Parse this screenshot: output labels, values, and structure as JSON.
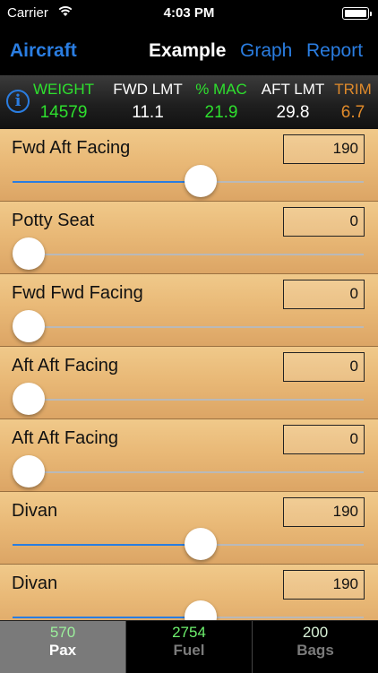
{
  "status": {
    "carrier": "Carrier",
    "time": "4:03 PM"
  },
  "nav": {
    "back": "Aircraft",
    "title": "Example",
    "graph": "Graph",
    "report": "Report"
  },
  "info": {
    "icon": "i"
  },
  "summary": {
    "weight_label": "WEIGHT",
    "weight_value": "14579",
    "fwd_label": "FWD LMT",
    "fwd_value": "11.1",
    "mac_label": "% MAC",
    "mac_value": "21.9",
    "aft_label": "AFT LMT",
    "aft_value": "29.8",
    "trim_label": "TRIM",
    "trim_value": "6.7",
    "colors": {
      "green": "#2ee02e",
      "white": "#ffffff",
      "orange": "#e08a2a",
      "blue": "#2a7de1"
    }
  },
  "seats": [
    {
      "name": "Fwd Aft Facing",
      "value": "190",
      "fraction": 0.54
    },
    {
      "name": "Potty Seat",
      "value": "0",
      "fraction": 0
    },
    {
      "name": "Fwd Fwd Facing",
      "value": "0",
      "fraction": 0
    },
    {
      "name": "Aft Aft Facing",
      "value": "0",
      "fraction": 0
    },
    {
      "name": "Aft Aft Facing",
      "value": "0",
      "fraction": 0
    },
    {
      "name": "Divan",
      "value": "190",
      "fraction": 0.54
    },
    {
      "name": "Divan",
      "value": "190",
      "fraction": 0.54
    }
  ],
  "tabs": [
    {
      "num": "570",
      "label": "Pax",
      "active": true
    },
    {
      "num": "2754",
      "label": "Fuel",
      "active": false
    },
    {
      "num": "200",
      "label": "Bags",
      "active": false
    }
  ]
}
